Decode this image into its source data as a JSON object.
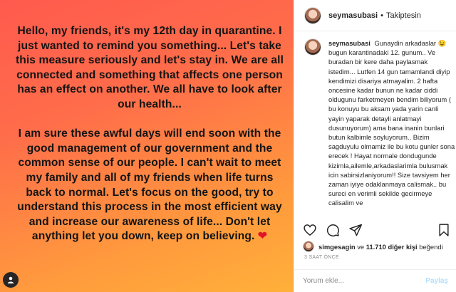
{
  "post": {
    "image_text": "Hello, my friends, it's my 12th day in quarantine. I just wanted to remind you something... Let's take this measure seriously and let's stay in.  We are all connected and something that affects one person has an effect on another. We all have to look after our health...\n\nI am sure these awful days will end soon with the good management of our government and the common sense of our people. I can't wait to meet my family and all of my friends when life turns back to normal.  Let's focus on the good, try to understand this process in the most efficient way and increase our awareness of life... Don't let anything let you down, keep on believing.",
    "heart_glyph": "❤"
  },
  "header": {
    "username": "seymasubasi",
    "separator": "•",
    "follow_status": "Takiptesin"
  },
  "caption": {
    "username": "seymasubasi",
    "text": "Gunaydin arkadaslar 😉 bugun karantinadaki 12. gunum.. Ve buradan bir kere daha paylasmak istedim... Lutfen 14 gun tamamlandi diyip kendimizi disariya atmayalim. 2 hafta oncesine kadar bunun ne kadar ciddi oldugunu farketmeyen bendim biliyorum ( bu konuyu bu aksam yada yarin canli yayin yaparak detayli anlatmayi dusunuyorum) ama bana inanin bunlari butun kalbimle soyluyorum.. Bizim sagduyulu olmamiz ile bu kotu gunler sona erecek ! Hayat normale dondugunde kizimla,ailemle,arkadaslarimla bulusmak icin sabirsizlaniyorum!! Size tavsiyem her zaman iyiye odaklanmaya calismak.. bu sureci en verimli sekilde gecirmeye calisalim ve"
  },
  "likes": {
    "first_liker": "simgesagin",
    "connector": "ve",
    "others": "11.710 diğer kişi",
    "suffix": "beğendi"
  },
  "time": "3 SAAT ÖNCE",
  "comment": {
    "placeholder": "Yorum ekle...",
    "post_label": "Paylaş"
  },
  "icons": [
    "heart-icon",
    "comment-icon",
    "share-icon",
    "bookmark-icon",
    "more-icon"
  ]
}
